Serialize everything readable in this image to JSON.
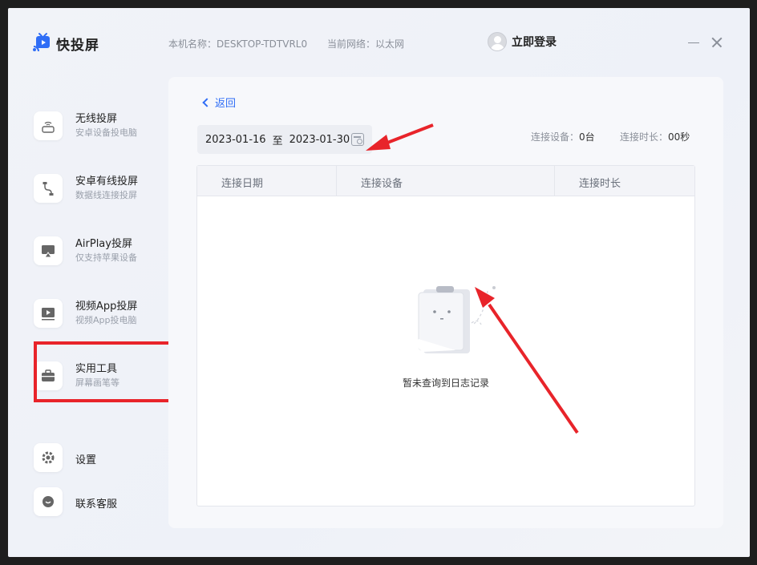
{
  "app": {
    "name": "快投屏",
    "machine_name": "本机名称：DESKTOP-TDTVRL0",
    "network": "当前网络：以太网",
    "login_label": "立即登录"
  },
  "sidebar": {
    "items": [
      {
        "title": "无线投屏",
        "subtitle": "安卓设备投电脑",
        "icon": "wifi-icon"
      },
      {
        "title": "安卓有线投屏",
        "subtitle": "数据线连接投屏",
        "icon": "usb-cable-icon"
      },
      {
        "title": "AirPlay投屏",
        "subtitle": "仅支持苹果设备",
        "icon": "airplay-icon"
      },
      {
        "title": "视频App投屏",
        "subtitle": "视频App投电脑",
        "icon": "video-play-icon"
      },
      {
        "title": "实用工具",
        "subtitle": "屏幕画笔等",
        "icon": "toolbox-icon"
      }
    ],
    "settings_label": "设置",
    "support_label": "联系客服"
  },
  "content": {
    "back_label": "返回",
    "date_start": "2023-01-16",
    "date_sep": "至",
    "date_end": "2023-01-30",
    "devices_label": "连接设备：",
    "devices_value": "0台",
    "duration_label": "连接时长：",
    "duration_value": "00秒",
    "table": {
      "columns": [
        "连接日期",
        "连接设备",
        "连接时长"
      ],
      "rows": [],
      "empty_text": "暂未查询到日志记录"
    }
  },
  "colors": {
    "accent": "#2f6df6",
    "annotation_red": "#e8242a"
  }
}
